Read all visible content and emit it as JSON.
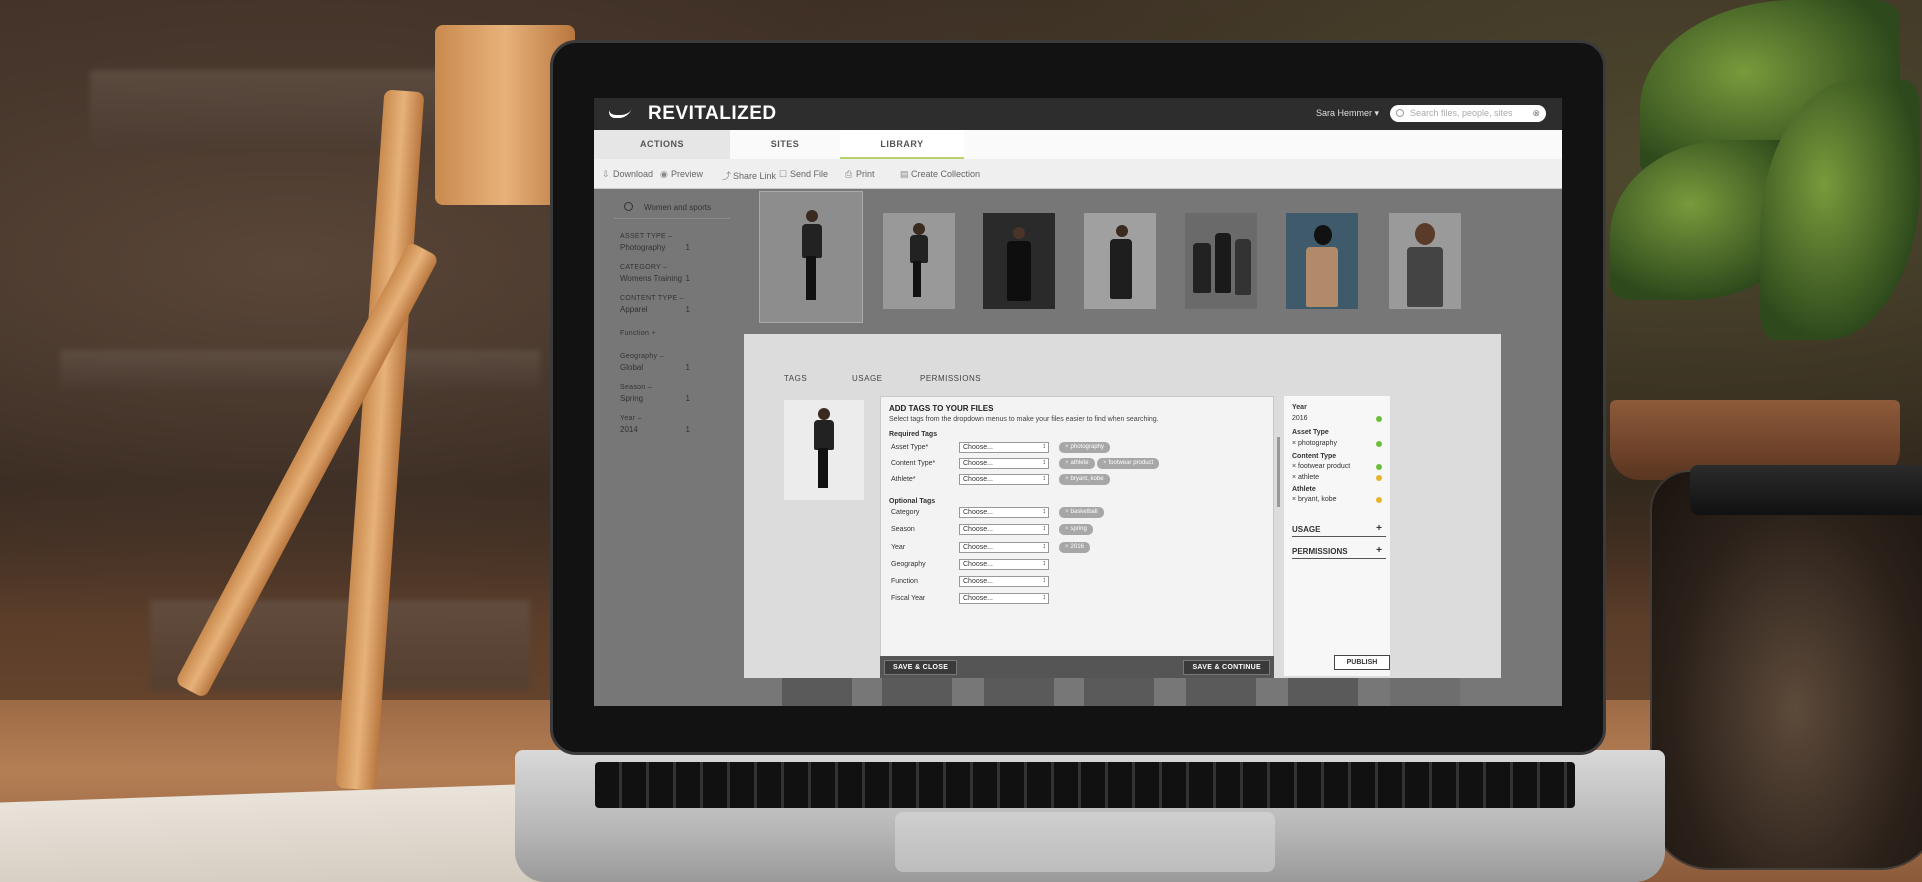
{
  "app": {
    "logo_text": "REVITALIZED",
    "user_name": "Sara Hemmer ▾",
    "search_placeholder": "Search files, people, sites"
  },
  "nav_tabs": [
    {
      "label": "ACTIONS"
    },
    {
      "label": "SITES"
    },
    {
      "label": "LIBRARY"
    }
  ],
  "toolbar": [
    {
      "label": "Download",
      "icon": "download-icon"
    },
    {
      "label": "Preview",
      "icon": "eye-icon"
    },
    {
      "label": "Share Link",
      "icon": "share-icon"
    },
    {
      "label": "Send File",
      "icon": "send-icon"
    },
    {
      "label": "Print",
      "icon": "printer-icon"
    },
    {
      "label": "Create Collection",
      "icon": "collection-icon"
    }
  ],
  "sidebar": {
    "search_value": "Women and sports",
    "facets": [
      {
        "title": "ASSET TYPE  –",
        "value": "Photography",
        "count": "1"
      },
      {
        "title": "CATEGORY  –",
        "value": "Womens Training",
        "count": "1"
      },
      {
        "title": "CONTENT TYPE  –",
        "value": "Apparel",
        "count": "1"
      },
      {
        "title": "Function  +",
        "value": "",
        "count": ""
      },
      {
        "title": "Geography  –",
        "value": "Global",
        "count": "1"
      },
      {
        "title": "Season  –",
        "value": "Spring",
        "count": "1"
      },
      {
        "title": "Year  –",
        "value": "2014",
        "count": "1"
      }
    ]
  },
  "modal": {
    "tabs": [
      "TAGS",
      "USAGE",
      "PERMISSIONS"
    ],
    "form_title": "ADD TAGS TO YOUR FILES",
    "form_subtitle": "Select tags from the dropdown menus to make your files easier to find when searching.",
    "required_heading": "Required Tags",
    "optional_heading": "Optional Tags",
    "select_placeholder": "Choose...",
    "required_rows": [
      {
        "label": "Asset Type*",
        "chips": [
          "photography"
        ]
      },
      {
        "label": "Content Type*",
        "chips": [
          "athlete",
          "footwear product"
        ]
      },
      {
        "label": "Athlete*",
        "chips": [
          "bryant, kobe"
        ]
      }
    ],
    "optional_rows": [
      {
        "label": "Category",
        "chips": [
          "basketball"
        ]
      },
      {
        "label": "Season",
        "chips": [
          "spring"
        ]
      },
      {
        "label": "Year",
        "chips": [
          "2016"
        ]
      },
      {
        "label": "Geography",
        "chips": []
      },
      {
        "label": "Function",
        "chips": []
      },
      {
        "label": "Fiscal Year",
        "chips": []
      }
    ],
    "save_close_label": "SAVE & CLOSE",
    "save_continue_label": "SAVE & CONTINUE",
    "summary": {
      "year_title": "Year",
      "year_value": "2016",
      "asset_title": "Asset Type",
      "asset_value": "× photography",
      "content_title": "Content Type",
      "content_values": [
        "× footwear product",
        "× athlete"
      ],
      "athlete_title": "Athlete",
      "athlete_value": "× bryant, kobe",
      "usage_label": "USAGE",
      "permissions_label": "PERMISSIONS",
      "plus_glyph": "+"
    },
    "publish_label": "PUBLISH"
  },
  "colors": {
    "status_complete": "#6cbf3c",
    "status_pending": "#e5b62b",
    "accent_underline": "#b7d26b"
  }
}
